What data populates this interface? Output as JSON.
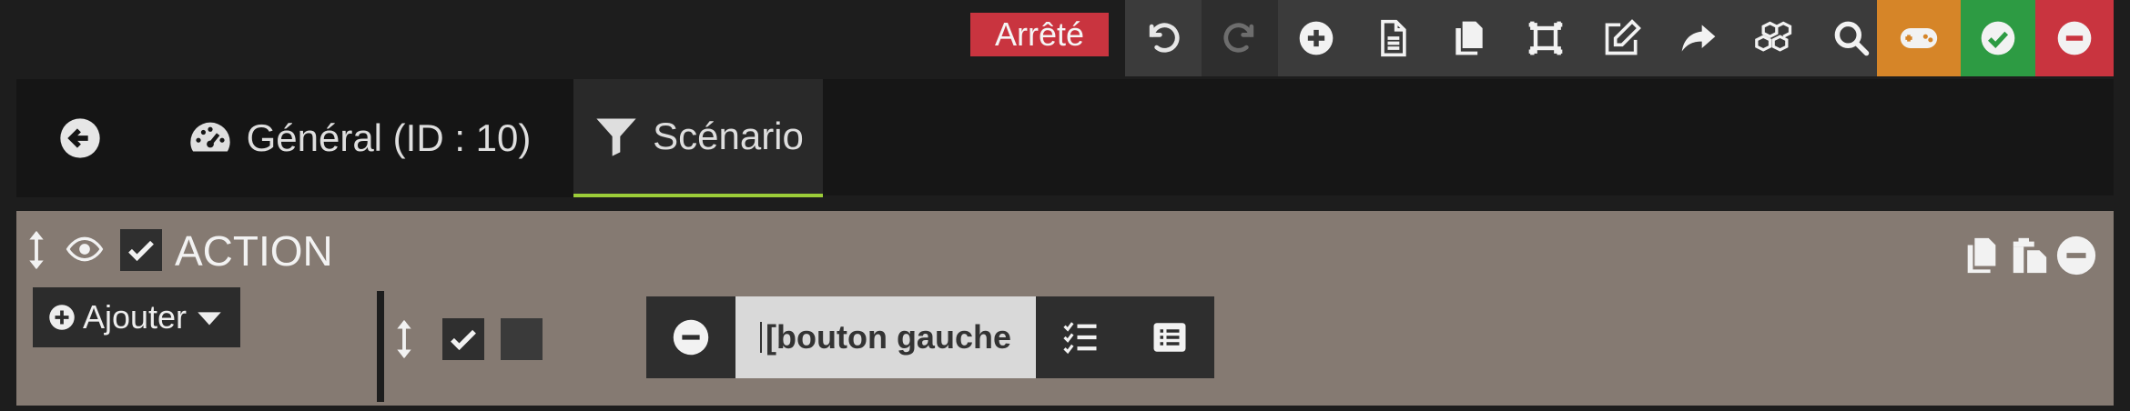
{
  "toolbar": {
    "status": "Arrêté",
    "buttons": [
      {
        "icon": "undo-icon",
        "bg": "#3b3b3b"
      },
      {
        "icon": "redo-icon",
        "bg": "#2e2e2e",
        "disabled": true
      },
      {
        "icon": "plus-circle-icon",
        "bg": "#3b3b3b"
      },
      {
        "icon": "file-icon",
        "bg": "#3b3b3b"
      },
      {
        "icon": "copy-icon",
        "bg": "#3b3b3b"
      },
      {
        "icon": "frame-icon",
        "bg": "#3b3b3b"
      },
      {
        "icon": "edit-icon",
        "bg": "#3b3b3b"
      },
      {
        "icon": "share-icon",
        "bg": "#3b3b3b"
      },
      {
        "icon": "cubes-icon",
        "bg": "#3b3b3b"
      },
      {
        "icon": "search-icon",
        "bg": "#3b3b3b"
      },
      {
        "icon": "gamepad-icon",
        "bg": "#d68528"
      },
      {
        "icon": "check-circle-icon",
        "bg": "#2d9b43"
      },
      {
        "icon": "minus-circle-icon",
        "bg": "#c9343f"
      }
    ]
  },
  "tabs": {
    "back_icon": "arrow-left-icon",
    "general": {
      "label": "Général (ID : 10)",
      "icon": "dashboard-icon"
    },
    "scenario": {
      "label": "Scénario",
      "icon": "filter-icon",
      "active": true,
      "accent": "#9ccd39"
    }
  },
  "action": {
    "title": "ACTION",
    "enabled": true,
    "add_button_label": "Ajouter",
    "command": {
      "value": "[bouton gauche",
      "enabled_checked": true,
      "second_checked": false
    },
    "right_icons": [
      "copy-icon",
      "paste-icon",
      "minus-circle-icon"
    ]
  },
  "colors": {
    "background": "#1d1d1d",
    "block_bg": "#857a72",
    "status_red": "#c9343f",
    "orange": "#d68528",
    "green": "#2d9b43"
  }
}
